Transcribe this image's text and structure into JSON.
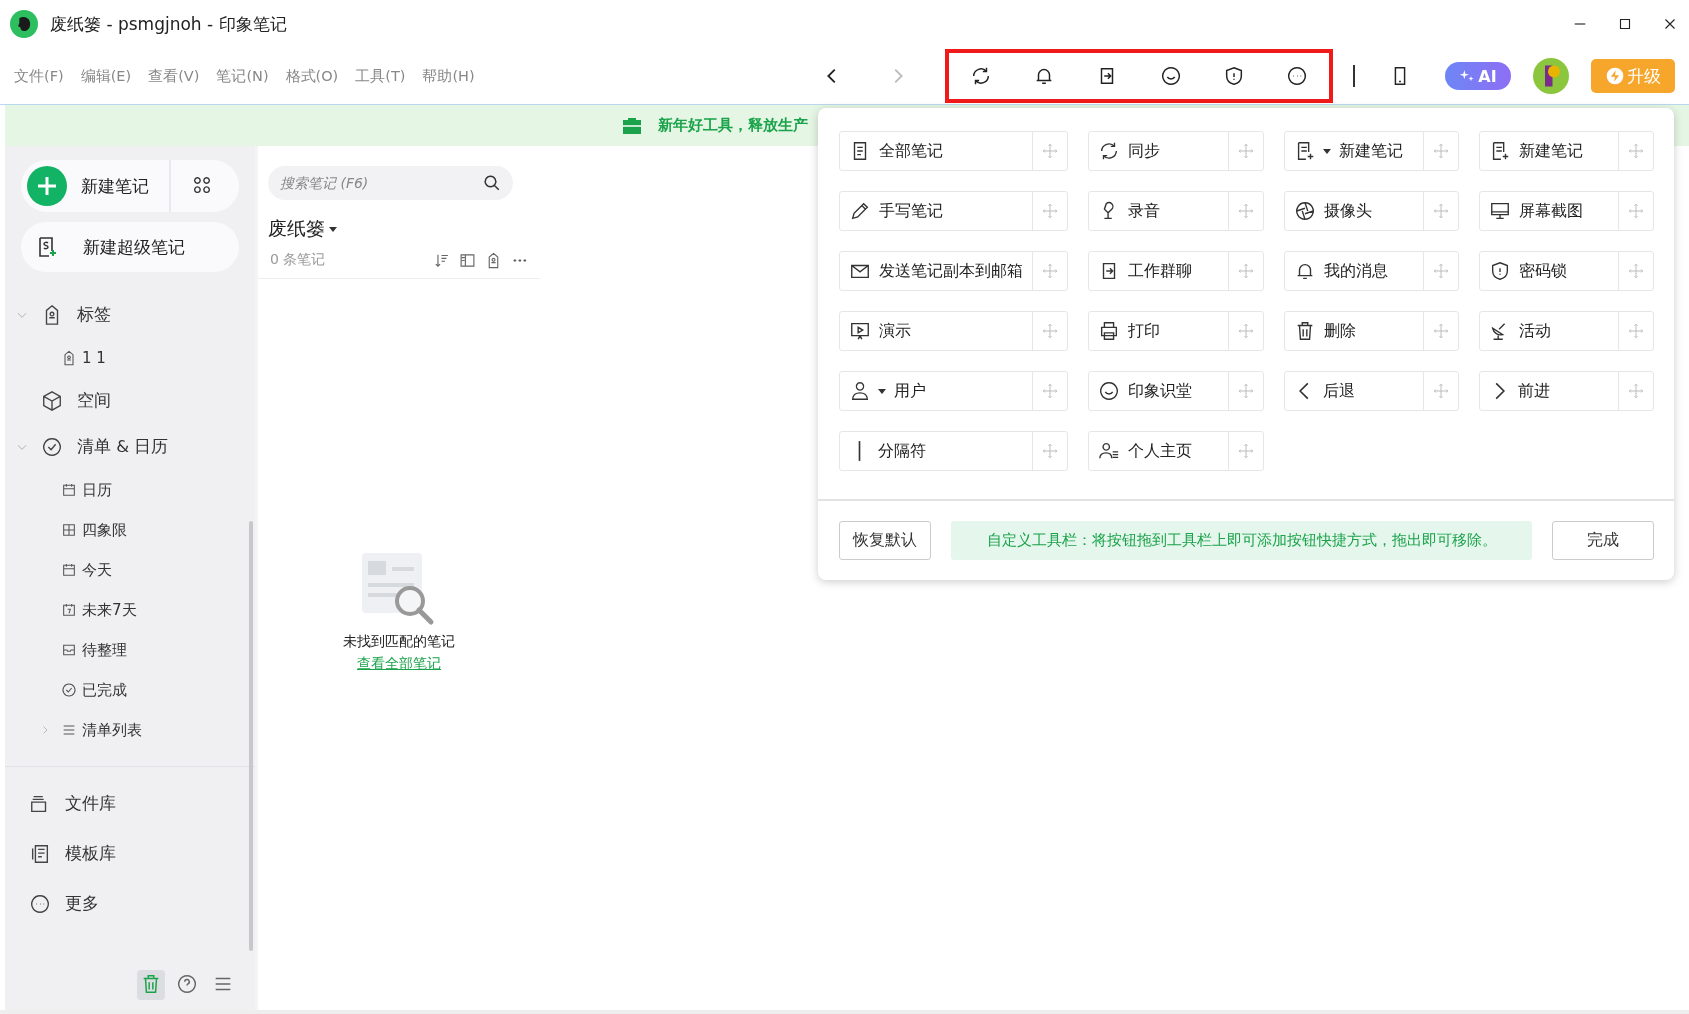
{
  "window": {
    "title": "废纸篓 - psmgjnoh - 印象笔记"
  },
  "menu": [
    "文件(F)",
    "编辑(E)",
    "查看(V)",
    "笔记(N)",
    "格式(O)",
    "工具(T)",
    "帮助(H)"
  ],
  "toolbar": {
    "ai_label": "AI",
    "upgrade_label": "升级"
  },
  "banner": {
    "text": "新年好工具，释放生产"
  },
  "sidebar": {
    "new_note": "新建笔记",
    "new_super_note": "新建超级笔记",
    "tree": [
      {
        "label": "标签",
        "expanded": true,
        "children": [
          {
            "label": "1  1"
          }
        ]
      },
      {
        "label": "空间"
      },
      {
        "label": "清单 & 日历",
        "expanded": true,
        "children": [
          {
            "label": "日历"
          },
          {
            "label": "四象限"
          },
          {
            "label": "今天"
          },
          {
            "label": "未来7天"
          },
          {
            "label": "待整理"
          },
          {
            "label": "已完成"
          },
          {
            "label": "清单列表",
            "expanded": false
          }
        ]
      }
    ],
    "bottom_items": [
      "文件库",
      "模板库",
      "更多"
    ],
    "footer_buttons": [
      {
        "selected": true
      },
      {
        "selected": false
      },
      {
        "selected": false
      }
    ]
  },
  "note_list": {
    "search": {
      "placeholder": "搜索笔记 (F6)"
    },
    "notebook": "废纸篓",
    "count": "0 条笔记",
    "empty_text": "未找到匹配的笔记",
    "empty_link": "查看全部笔记"
  },
  "customize_panel": {
    "items": [
      {
        "label": "全部笔记",
        "kind": "plain"
      },
      {
        "label": "同步",
        "kind": "plain"
      },
      {
        "label": "新建笔记",
        "kind": "dropdown"
      },
      {
        "label": "新建笔记",
        "kind": "plain"
      },
      {
        "label": "手写笔记",
        "kind": "plain"
      },
      {
        "label": "录音",
        "kind": "plain"
      },
      {
        "label": "摄像头",
        "kind": "plain"
      },
      {
        "label": "屏幕截图",
        "kind": "plain"
      },
      {
        "label": "发送笔记副本到邮箱",
        "kind": "plain"
      },
      {
        "label": "工作群聊",
        "kind": "plain"
      },
      {
        "label": "我的消息",
        "kind": "plain"
      },
      {
        "label": "密码锁",
        "kind": "plain"
      },
      {
        "label": "演示",
        "kind": "plain"
      },
      {
        "label": "打印",
        "kind": "plain"
      },
      {
        "label": "删除",
        "kind": "plain"
      },
      {
        "label": "活动",
        "kind": "plain"
      },
      {
        "label": "用户",
        "kind": "dropdown"
      },
      {
        "label": "印象识堂",
        "kind": "plain"
      },
      {
        "label": "后退",
        "kind": "plain"
      },
      {
        "label": "前进",
        "kind": "plain"
      },
      {
        "label": "分隔符",
        "kind": "plain"
      },
      {
        "label": "个人主页",
        "kind": "plain"
      }
    ],
    "restore_button": "恢复默认",
    "hint": "自定义工具栏：将按钮拖到工具栏上即可添加按钮快捷方式，拖出即可移除。",
    "done_button": "完成"
  }
}
